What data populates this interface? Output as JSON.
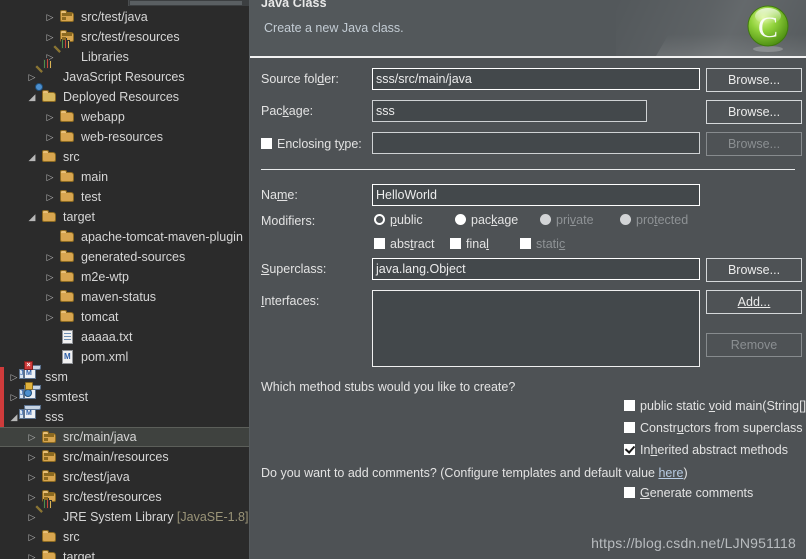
{
  "explorer": {
    "name": "package-explorer",
    "rows": [
      {
        "indent": 3,
        "arrow": "collapsed",
        "icon": "source-folder-icon",
        "label": "src/test/java"
      },
      {
        "indent": 3,
        "arrow": "collapsed",
        "icon": "source-folder-icon",
        "label": "src/test/resources"
      },
      {
        "indent": 3,
        "arrow": "collapsed",
        "icon": "library-icon",
        "label": "Libraries"
      },
      {
        "indent": 2,
        "arrow": "collapsed",
        "icon": "library-icon",
        "label": "JavaScript Resources"
      },
      {
        "indent": 2,
        "arrow": "expanded",
        "icon": "deployed-resources-icon",
        "label": "Deployed Resources"
      },
      {
        "indent": 3,
        "arrow": "collapsed",
        "icon": "folder-icon",
        "label": "webapp"
      },
      {
        "indent": 3,
        "arrow": "collapsed",
        "icon": "folder-icon",
        "label": "web-resources"
      },
      {
        "indent": 2,
        "arrow": "expanded",
        "icon": "folder-icon",
        "label": "src"
      },
      {
        "indent": 3,
        "arrow": "collapsed",
        "icon": "folder-icon",
        "label": "main"
      },
      {
        "indent": 3,
        "arrow": "collapsed",
        "icon": "folder-icon",
        "label": "test"
      },
      {
        "indent": 2,
        "arrow": "expanded",
        "icon": "folder-icon",
        "label": "target"
      },
      {
        "indent": 3,
        "arrow": "none",
        "icon": "folder-icon",
        "label": "apache-tomcat-maven-plugin"
      },
      {
        "indent": 3,
        "arrow": "collapsed",
        "icon": "folder-icon",
        "label": "generated-sources"
      },
      {
        "indent": 3,
        "arrow": "collapsed",
        "icon": "folder-icon",
        "label": "m2e-wtp"
      },
      {
        "indent": 3,
        "arrow": "collapsed",
        "icon": "folder-icon",
        "label": "maven-status"
      },
      {
        "indent": 3,
        "arrow": "collapsed",
        "icon": "folder-icon",
        "label": "tomcat"
      },
      {
        "indent": 3,
        "arrow": "none",
        "icon": "text-file-icon",
        "label": "aaaaa.txt"
      },
      {
        "indent": 3,
        "arrow": "none",
        "icon": "xml-file-icon",
        "label": "pom.xml"
      },
      {
        "indent": 1,
        "arrow": "collapsed",
        "icon": "project-error-icon",
        "label": "ssm",
        "marker": true
      },
      {
        "indent": 1,
        "arrow": "collapsed",
        "icon": "project-locked-icon",
        "label": "ssmtest",
        "marker": true
      },
      {
        "indent": 1,
        "arrow": "expanded",
        "icon": "project-icon",
        "label": "sss",
        "marker": true
      },
      {
        "indent": 2,
        "arrow": "collapsed",
        "icon": "source-folder-icon",
        "label": "src/main/java",
        "selected": true
      },
      {
        "indent": 2,
        "arrow": "collapsed",
        "icon": "source-folder-icon",
        "label": "src/main/resources"
      },
      {
        "indent": 2,
        "arrow": "collapsed",
        "icon": "source-folder-icon",
        "label": "src/test/java"
      },
      {
        "indent": 2,
        "arrow": "collapsed",
        "icon": "source-folder-icon",
        "label": "src/test/resources"
      },
      {
        "indent": 2,
        "arrow": "collapsed",
        "icon": "library-icon",
        "label": "JRE System Library ",
        "dim": "[JavaSE-1.8]"
      },
      {
        "indent": 2,
        "arrow": "collapsed",
        "icon": "folder-icon",
        "label": "src"
      },
      {
        "indent": 2,
        "arrow": "collapsed",
        "icon": "folder-icon",
        "label": "target"
      }
    ]
  },
  "dialog": {
    "title": "Java Class",
    "subtitle": "Create a new Java class.",
    "logo_icon": "new-java-class-icon",
    "fields": {
      "source_folder": {
        "label": "Source folder:",
        "label_pre": "Source fol",
        "label_key": "d",
        "label_post": "er:",
        "value": "sss/src/main/java",
        "browse": "Browse..."
      },
      "package": {
        "label": "Package:",
        "label_pre": "Pac",
        "label_key": "k",
        "label_post": "age:",
        "value": "sss",
        "browse": "Browse..."
      },
      "enclosing_type": {
        "label": "Enclosing type:",
        "label_pre": "Enclosing t",
        "label_key": "y",
        "label_post": "pe:",
        "value": "",
        "checked": false,
        "browse": "Browse...",
        "browse_disabled": true
      },
      "name": {
        "label": "Name:",
        "label_pre": "Na",
        "label_key": "m",
        "label_post": "e:",
        "value": "HelloWorld"
      },
      "superclass": {
        "label": "Superclass:",
        "label_pre": "",
        "label_key": "S",
        "label_post": "uperclass:",
        "value": "java.lang.Object",
        "browse": "Browse..."
      },
      "interfaces": {
        "label": "Interfaces:",
        "label_pre": "",
        "label_key": "I",
        "label_post": "nterfaces:",
        "value": "",
        "add": "Add...",
        "remove": "Remove",
        "remove_disabled": true
      }
    },
    "modifiers": {
      "label": "Modifiers:",
      "access": [
        {
          "label": "public",
          "pre": "",
          "key": "p",
          "post": "ublic",
          "checked": true,
          "disabled": false
        },
        {
          "label": "package",
          "pre": "pac",
          "key": "k",
          "post": "age",
          "checked": false,
          "disabled": false
        },
        {
          "label": "private",
          "pre": "pri",
          "key": "v",
          "post": "ate",
          "checked": false,
          "disabled": true
        },
        {
          "label": "protected",
          "pre": "pro",
          "key": "t",
          "post": "ected",
          "checked": false,
          "disabled": true
        }
      ],
      "flags": [
        {
          "label": "abstract",
          "pre": "abs",
          "key": "t",
          "post": "ract",
          "checked": false,
          "disabled": false
        },
        {
          "label": "final",
          "pre": "fina",
          "key": "l",
          "post": "",
          "checked": false,
          "disabled": false
        },
        {
          "label": "static",
          "pre": "stati",
          "key": "c",
          "post": "",
          "checked": false,
          "disabled": true
        }
      ]
    },
    "stubs": {
      "question": "Which method stubs would you like to create?",
      "items": [
        {
          "label": "public static void main(String[] args)",
          "pre": "public static ",
          "key": "v",
          "post": "oid main(String[] args)",
          "checked": false
        },
        {
          "label": "Constructors from superclass",
          "pre": "Constr",
          "key": "u",
          "post": "ctors from superclass",
          "checked": false
        },
        {
          "label": "Inherited abstract methods",
          "pre": "In",
          "key": "h",
          "post": "erited abstract methods",
          "checked": true
        }
      ]
    },
    "comments": {
      "question_pre": "Do you want to add comments? (Configure templates and default value ",
      "link": "here",
      "question_post": ")",
      "checkbox": {
        "label": "Generate comments",
        "pre": "",
        "key": "G",
        "post": "enerate comments",
        "checked": false
      }
    }
  },
  "watermark": "https://blog.csdn.net/LJN951118"
}
